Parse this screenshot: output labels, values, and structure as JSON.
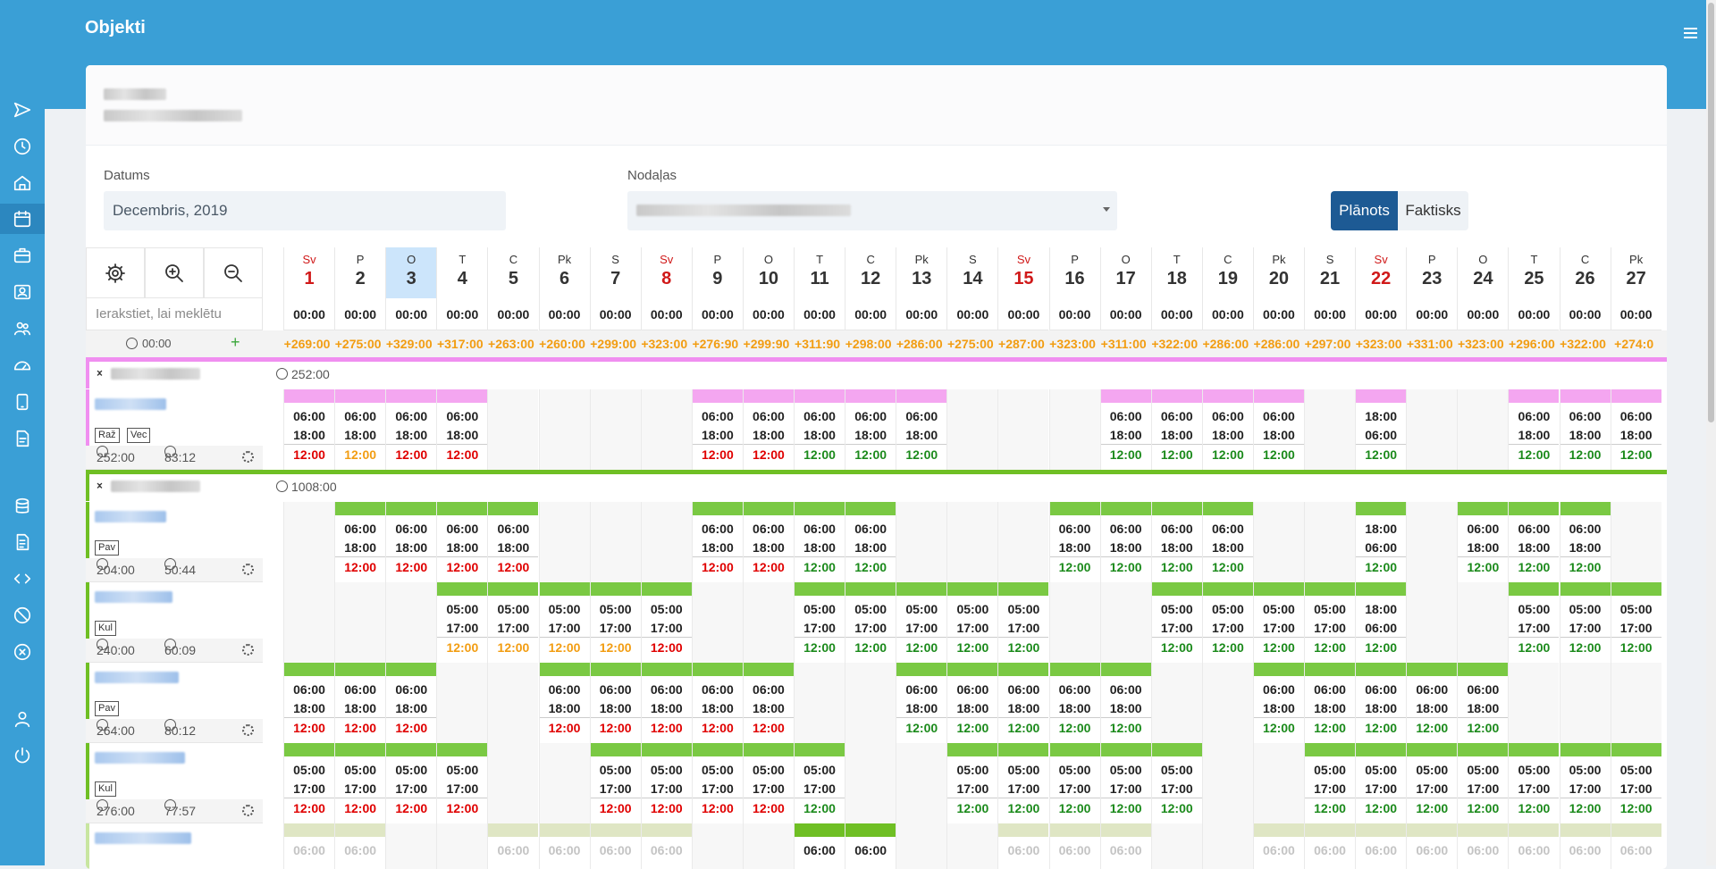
{
  "app": {
    "title": "Objekti"
  },
  "sidebar": {
    "icons": [
      "send-icon",
      "clock-icon",
      "home-icon",
      "calendar-icon",
      "briefcase-icon",
      "contact-card-icon",
      "users-icon",
      "dashboard-icon",
      "tablet-icon",
      "report-icon",
      "database-icon",
      "document-icon",
      "code-icon",
      "block-icon",
      "cancel-icon",
      "user-icon",
      "power-icon"
    ]
  },
  "filters": {
    "date_label": "Datums",
    "date_value": "Decembris, 2019",
    "dept_label": "Nodaļas",
    "mode_planned": "Plānots",
    "mode_actual": "Faktisks"
  },
  "toolbar": {
    "settings_icon": "gear-icon",
    "zoom_in_icon": "zoom-in-icon",
    "zoom_out_icon": "zoom-out-icon"
  },
  "search": {
    "placeholder": "Ierakstiet, lai meklētu"
  },
  "summary": {
    "time": "00:00",
    "add": "+"
  },
  "days": [
    {
      "wd": "Sv",
      "num": "1",
      "total": "00:00",
      "sum": "+269:00",
      "sun": true
    },
    {
      "wd": "P",
      "num": "2",
      "total": "00:00",
      "sum": "+275:00"
    },
    {
      "wd": "O",
      "num": "3",
      "total": "00:00",
      "sum": "+329:00",
      "today": true
    },
    {
      "wd": "T",
      "num": "4",
      "total": "00:00",
      "sum": "+317:00"
    },
    {
      "wd": "C",
      "num": "5",
      "total": "00:00",
      "sum": "+263:00"
    },
    {
      "wd": "Pk",
      "num": "6",
      "total": "00:00",
      "sum": "+260:00"
    },
    {
      "wd": "S",
      "num": "7",
      "total": "00:00",
      "sum": "+299:00"
    },
    {
      "wd": "Sv",
      "num": "8",
      "total": "00:00",
      "sum": "+323:00",
      "sun": true
    },
    {
      "wd": "P",
      "num": "9",
      "total": "00:00",
      "sum": "+276:90"
    },
    {
      "wd": "O",
      "num": "10",
      "total": "00:00",
      "sum": "+299:90"
    },
    {
      "wd": "T",
      "num": "11",
      "total": "00:00",
      "sum": "+311:90"
    },
    {
      "wd": "C",
      "num": "12",
      "total": "00:00",
      "sum": "+298:00"
    },
    {
      "wd": "Pk",
      "num": "13",
      "total": "00:00",
      "sum": "+286:00"
    },
    {
      "wd": "S",
      "num": "14",
      "total": "00:00",
      "sum": "+275:00"
    },
    {
      "wd": "Sv",
      "num": "15",
      "total": "00:00",
      "sum": "+287:00",
      "sun": true
    },
    {
      "wd": "P",
      "num": "16",
      "total": "00:00",
      "sum": "+323:00"
    },
    {
      "wd": "O",
      "num": "17",
      "total": "00:00",
      "sum": "+311:00"
    },
    {
      "wd": "T",
      "num": "18",
      "total": "00:00",
      "sum": "+322:00"
    },
    {
      "wd": "C",
      "num": "19",
      "total": "00:00",
      "sum": "+286:00"
    },
    {
      "wd": "Pk",
      "num": "20",
      "total": "00:00",
      "sum": "+286:00"
    },
    {
      "wd": "S",
      "num": "21",
      "total": "00:00",
      "sum": "+297:00"
    },
    {
      "wd": "Sv",
      "num": "22",
      "total": "00:00",
      "sum": "+323:00",
      "sun": true
    },
    {
      "wd": "P",
      "num": "23",
      "total": "00:00",
      "sum": "+331:00"
    },
    {
      "wd": "O",
      "num": "24",
      "total": "00:00",
      "sum": "+323:00"
    },
    {
      "wd": "T",
      "num": "25",
      "total": "00:00",
      "sum": "+296:00"
    },
    {
      "wd": "C",
      "num": "26",
      "total": "00:00",
      "sum": "+322:00"
    },
    {
      "wd": "Pk",
      "num": "27",
      "total": "00:00",
      "sum": "+274:0"
    }
  ],
  "groups": [
    {
      "total": "252:00",
      "color": "#f08ff0",
      "employees": [
        {
          "tags": [
            "Raž",
            "Vec"
          ],
          "hours": "252:00",
          "overtime": "83:12",
          "bar": "#f4a6f0",
          "shifts": [
            [
              0,
              "06:00",
              "18:00",
              "12:00",
              "r"
            ],
            [
              1,
              "06:00",
              "18:00",
              "12:00",
              "o"
            ],
            [
              2,
              "06:00",
              "18:00",
              "12:00",
              "r"
            ],
            [
              3,
              "06:00",
              "18:00",
              "12:00",
              "r"
            ],
            [
              8,
              "06:00",
              "18:00",
              "12:00",
              "r"
            ],
            [
              9,
              "06:00",
              "18:00",
              "12:00",
              "r"
            ],
            [
              10,
              "06:00",
              "18:00",
              "12:00",
              "g"
            ],
            [
              11,
              "06:00",
              "18:00",
              "12:00",
              "g"
            ],
            [
              12,
              "06:00",
              "18:00",
              "12:00",
              "g"
            ],
            [
              16,
              "06:00",
              "18:00",
              "12:00",
              "g"
            ],
            [
              17,
              "06:00",
              "18:00",
              "12:00",
              "g"
            ],
            [
              18,
              "06:00",
              "18:00",
              "12:00",
              "g"
            ],
            [
              19,
              "06:00",
              "18:00",
              "12:00",
              "g"
            ],
            [
              21,
              "18:00",
              "06:00",
              "12:00",
              "g"
            ],
            [
              24,
              "06:00",
              "18:00",
              "12:00",
              "g"
            ],
            [
              25,
              "06:00",
              "18:00",
              "12:00",
              "g"
            ],
            [
              26,
              "06:00",
              "18:00",
              "12:00",
              "g"
            ]
          ]
        }
      ]
    },
    {
      "total": "1008:00",
      "color": "#6fbf24",
      "employees": [
        {
          "tags": [
            "Pav"
          ],
          "hours": "204:00",
          "overtime": "50:44",
          "bar": "#7ac943",
          "shifts": [
            [
              1,
              "06:00",
              "18:00",
              "12:00",
              "r"
            ],
            [
              2,
              "06:00",
              "18:00",
              "12:00",
              "r"
            ],
            [
              3,
              "06:00",
              "18:00",
              "12:00",
              "r"
            ],
            [
              4,
              "06:00",
              "18:00",
              "12:00",
              "r"
            ],
            [
              8,
              "06:00",
              "18:00",
              "12:00",
              "r"
            ],
            [
              9,
              "06:00",
              "18:00",
              "12:00",
              "r"
            ],
            [
              10,
              "06:00",
              "18:00",
              "12:00",
              "g"
            ],
            [
              11,
              "06:00",
              "18:00",
              "12:00",
              "g"
            ],
            [
              15,
              "06:00",
              "18:00",
              "12:00",
              "g"
            ],
            [
              16,
              "06:00",
              "18:00",
              "12:00",
              "g"
            ],
            [
              17,
              "06:00",
              "18:00",
              "12:00",
              "g"
            ],
            [
              18,
              "06:00",
              "18:00",
              "12:00",
              "g"
            ],
            [
              21,
              "18:00",
              "06:00",
              "12:00",
              "g"
            ],
            [
              23,
              "06:00",
              "18:00",
              "12:00",
              "g"
            ],
            [
              24,
              "06:00",
              "18:00",
              "12:00",
              "g"
            ],
            [
              25,
              "06:00",
              "18:00",
              "12:00",
              "g"
            ]
          ]
        },
        {
          "tags": [
            "Kul"
          ],
          "hours": "240:00",
          "overtime": "60:09",
          "bar": "#7ac943",
          "shifts": [
            [
              3,
              "05:00",
              "17:00",
              "12:00",
              "o"
            ],
            [
              4,
              "05:00",
              "17:00",
              "12:00",
              "o"
            ],
            [
              5,
              "05:00",
              "17:00",
              "12:00",
              "o"
            ],
            [
              6,
              "05:00",
              "17:00",
              "12:00",
              "o"
            ],
            [
              7,
              "05:00",
              "17:00",
              "12:00",
              "r"
            ],
            [
              10,
              "05:00",
              "17:00",
              "12:00",
              "g"
            ],
            [
              11,
              "05:00",
              "17:00",
              "12:00",
              "g"
            ],
            [
              12,
              "05:00",
              "17:00",
              "12:00",
              "g"
            ],
            [
              13,
              "05:00",
              "17:00",
              "12:00",
              "g"
            ],
            [
              14,
              "05:00",
              "17:00",
              "12:00",
              "g"
            ],
            [
              17,
              "05:00",
              "17:00",
              "12:00",
              "g"
            ],
            [
              18,
              "05:00",
              "17:00",
              "12:00",
              "g"
            ],
            [
              19,
              "05:00",
              "17:00",
              "12:00",
              "g"
            ],
            [
              20,
              "05:00",
              "17:00",
              "12:00",
              "g"
            ],
            [
              21,
              "18:00",
              "06:00",
              "12:00",
              "g"
            ],
            [
              24,
              "05:00",
              "17:00",
              "12:00",
              "g"
            ],
            [
              25,
              "05:00",
              "17:00",
              "12:00",
              "g"
            ],
            [
              26,
              "05:00",
              "17:00",
              "12:00",
              "g"
            ]
          ]
        },
        {
          "tags": [
            "Pav"
          ],
          "hours": "264:00",
          "overtime": "80:12",
          "bar": "#7ac943",
          "shifts": [
            [
              0,
              "06:00",
              "18:00",
              "12:00",
              "r"
            ],
            [
              1,
              "06:00",
              "18:00",
              "12:00",
              "r"
            ],
            [
              2,
              "06:00",
              "18:00",
              "12:00",
              "r"
            ],
            [
              5,
              "06:00",
              "18:00",
              "12:00",
              "r"
            ],
            [
              6,
              "06:00",
              "18:00",
              "12:00",
              "r"
            ],
            [
              7,
              "06:00",
              "18:00",
              "12:00",
              "r"
            ],
            [
              8,
              "06:00",
              "18:00",
              "12:00",
              "r"
            ],
            [
              9,
              "06:00",
              "18:00",
              "12:00",
              "r"
            ],
            [
              12,
              "06:00",
              "18:00",
              "12:00",
              "g"
            ],
            [
              13,
              "06:00",
              "18:00",
              "12:00",
              "g"
            ],
            [
              14,
              "06:00",
              "18:00",
              "12:00",
              "g"
            ],
            [
              15,
              "06:00",
              "18:00",
              "12:00",
              "g"
            ],
            [
              16,
              "06:00",
              "18:00",
              "12:00",
              "g"
            ],
            [
              19,
              "06:00",
              "18:00",
              "12:00",
              "g"
            ],
            [
              20,
              "06:00",
              "18:00",
              "12:00",
              "g"
            ],
            [
              21,
              "06:00",
              "18:00",
              "12:00",
              "g"
            ],
            [
              22,
              "06:00",
              "18:00",
              "12:00",
              "g"
            ],
            [
              23,
              "06:00",
              "18:00",
              "12:00",
              "g"
            ]
          ]
        },
        {
          "tags": [
            "Kul"
          ],
          "hours": "276:00",
          "overtime": "77:57",
          "bar": "#7ac943",
          "shifts": [
            [
              0,
              "05:00",
              "17:00",
              "12:00",
              "r"
            ],
            [
              1,
              "05:00",
              "17:00",
              "12:00",
              "r"
            ],
            [
              2,
              "05:00",
              "17:00",
              "12:00",
              "r"
            ],
            [
              3,
              "05:00",
              "17:00",
              "12:00",
              "r"
            ],
            [
              6,
              "05:00",
              "17:00",
              "12:00",
              "r"
            ],
            [
              7,
              "05:00",
              "17:00",
              "12:00",
              "r"
            ],
            [
              8,
              "05:00",
              "17:00",
              "12:00",
              "r"
            ],
            [
              9,
              "05:00",
              "17:00",
              "12:00",
              "r"
            ],
            [
              10,
              "05:00",
              "17:00",
              "12:00",
              "g"
            ],
            [
              13,
              "05:00",
              "17:00",
              "12:00",
              "g"
            ],
            [
              14,
              "05:00",
              "17:00",
              "12:00",
              "g"
            ],
            [
              15,
              "05:00",
              "17:00",
              "12:00",
              "g"
            ],
            [
              16,
              "05:00",
              "17:00",
              "12:00",
              "g"
            ],
            [
              17,
              "05:00",
              "17:00",
              "12:00",
              "g"
            ],
            [
              20,
              "05:00",
              "17:00",
              "12:00",
              "g"
            ],
            [
              21,
              "05:00",
              "17:00",
              "12:00",
              "g"
            ],
            [
              22,
              "05:00",
              "17:00",
              "12:00",
              "g"
            ],
            [
              23,
              "05:00",
              "17:00",
              "12:00",
              "g"
            ],
            [
              24,
              "05:00",
              "17:00",
              "12:00",
              "g"
            ],
            [
              25,
              "05:00",
              "17:00",
              "12:00",
              "g"
            ],
            [
              26,
              "05:00",
              "17:00",
              "12:00",
              "g"
            ]
          ]
        },
        {
          "tags": [],
          "hours": "",
          "overtime": "",
          "bar": "#d6e0b8",
          "faded": true,
          "shifts": [
            [
              0,
              "06:00",
              "",
              "",
              "f"
            ],
            [
              1,
              "06:00",
              "",
              "",
              "f"
            ],
            [
              4,
              "06:00",
              "",
              "",
              "f"
            ],
            [
              5,
              "06:00",
              "",
              "",
              "f"
            ],
            [
              6,
              "06:00",
              "",
              "",
              "f"
            ],
            [
              7,
              "06:00",
              "",
              "",
              "f"
            ],
            [
              10,
              "06:00",
              "",
              "",
              "n"
            ],
            [
              11,
              "06:00",
              "",
              "",
              "n"
            ],
            [
              14,
              "06:00",
              "",
              "",
              "f"
            ],
            [
              15,
              "06:00",
              "",
              "",
              "f"
            ],
            [
              16,
              "06:00",
              "",
              "",
              "f"
            ],
            [
              19,
              "06:00",
              "",
              "",
              "f"
            ],
            [
              20,
              "06:00",
              "",
              "",
              "f"
            ],
            [
              21,
              "06:00",
              "",
              "",
              "f"
            ],
            [
              22,
              "06:00",
              "",
              "",
              "f"
            ],
            [
              23,
              "06:00",
              "",
              "",
              "f"
            ],
            [
              24,
              "06:00",
              "",
              "",
              "f"
            ],
            [
              25,
              "06:00",
              "",
              "",
              "f"
            ],
            [
              26,
              "06:00",
              "",
              "",
              "f"
            ]
          ]
        }
      ]
    }
  ]
}
